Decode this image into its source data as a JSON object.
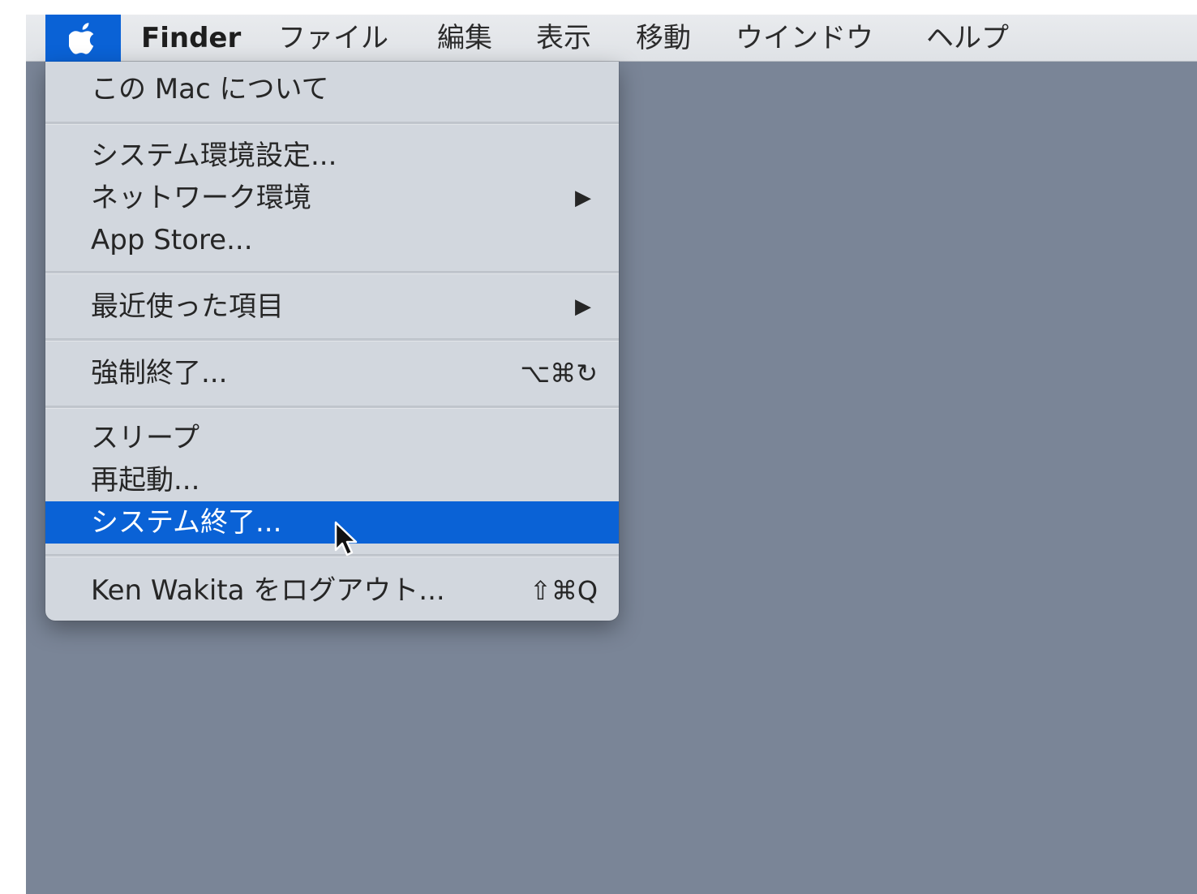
{
  "menubar": {
    "apple_icon": "apple-logo-icon",
    "app_name": "Finder",
    "menus": [
      "ファイル",
      "編集",
      "表示",
      "移動",
      "ウインドウ",
      "ヘルプ"
    ]
  },
  "apple_menu": {
    "items": [
      {
        "label": "この Mac について"
      },
      {
        "label": "システム環境設定..."
      },
      {
        "label": "ネットワーク環境",
        "submenu_icon": "submenu-arrow-icon"
      },
      {
        "label": "App Store..."
      },
      {
        "label": "最近使った項目",
        "submenu_icon": "submenu-arrow-icon"
      },
      {
        "label": "強制終了...",
        "shortcut": "⌥⌘↻"
      },
      {
        "label": "スリープ"
      },
      {
        "label": "再起動..."
      },
      {
        "label": "システム終了...",
        "selected": true
      },
      {
        "label": "Ken Wakita をログアウト...",
        "shortcut": "⇧⌘Q"
      }
    ]
  },
  "colors": {
    "desktop": "#7a8597",
    "menubar": "#e4e7ea",
    "menu_background": "#d2d7de",
    "selection": "#0a62d6"
  },
  "cursor_icon": "mouse-pointer-icon"
}
